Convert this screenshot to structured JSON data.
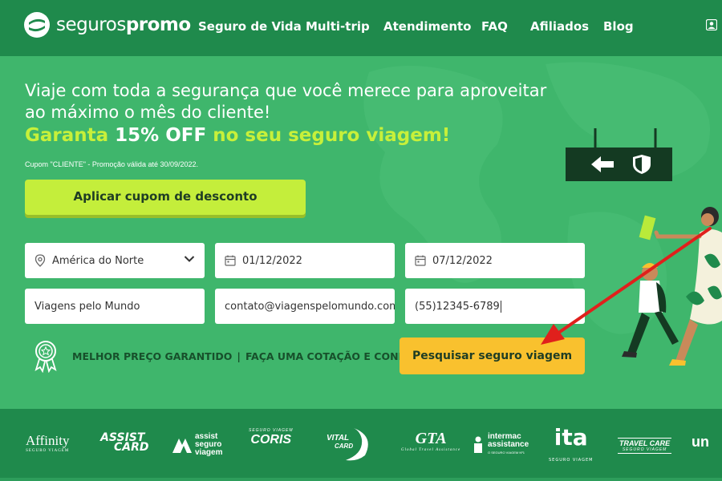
{
  "nav": {
    "logo_light": "seguros",
    "logo_bold": "promo",
    "links": [
      "Seguro de Vida",
      "Multi-trip",
      "Atendimento",
      "FAQ",
      "Afiliados",
      "Blog"
    ]
  },
  "hero": {
    "headline": "Viaje com toda a segurança que você merece para aproveitar ao máximo o mês do cliente!",
    "promo_part1": "Garanta",
    "promo_part2": "15% OFF",
    "promo_part3": "no seu seguro viagem!",
    "coupon_note": "Cupom \"CLIENTE\" - Promoção válida até 30/09/2022.",
    "apply_button": "Aplicar cupom de desconto"
  },
  "form": {
    "destination": "América do Norte",
    "departure_date": "01/12/2022",
    "return_date": "07/12/2022",
    "name": "Viagens pelo Mundo",
    "email": "contato@viagenspelomundo.com",
    "phone": "(55)12345-6789",
    "search_button": "Pesquisar seguro viagem"
  },
  "guarantee": {
    "part1": "MELHOR PREÇO GARANTIDO",
    "separator": "|",
    "part2": "FAÇA UMA COTAÇÃO E CONFIRA."
  },
  "partners": {
    "affinity": "Affinity",
    "affinity_sub": "SEGURO VIAGEM",
    "assist_card_1": "ASSIST",
    "assist_card_2": "CARD",
    "assist_seguro": "assist seguro viagem",
    "coris_sub": "SEGURO VIAGEM",
    "coris": "CORIS",
    "vital_card_1": "VITAL",
    "vital_card_2": "CARD",
    "gta": "GTA",
    "gta_sub": "Global Travel Assistance",
    "intermac": "intermac assistance",
    "intermac_sub": "O SEGURO VIAGEM Nº1",
    "ita": "ita",
    "ita_sub": "SEGURO VIAGEM",
    "travel_care": "TRAVEL CARE",
    "travel_care_sub": "SEGURO VIAGEM",
    "universal": "un"
  },
  "colors": {
    "nav_bg": "#1f8a4c",
    "hero_bg": "#3fb66c",
    "accent_lime": "#c7f03a",
    "button_yellow": "#f9c12e",
    "arrow_red": "#e0201c"
  }
}
